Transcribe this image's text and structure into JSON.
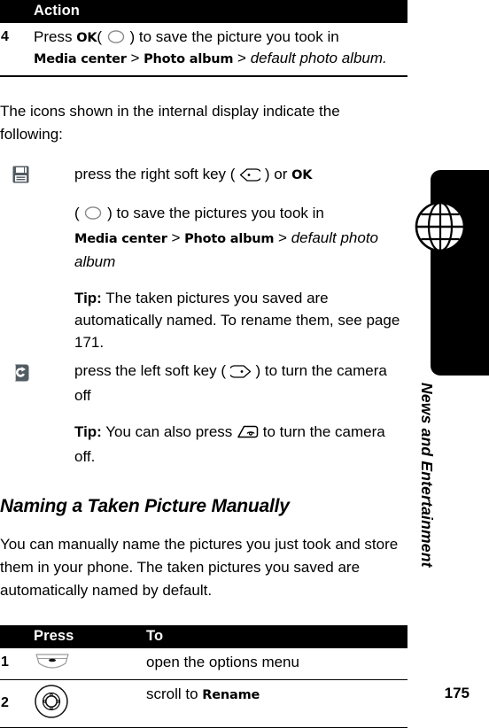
{
  "page": {
    "number": "175",
    "sidebar_label": "News and Entertainment",
    "globe_icon": "globe-icon"
  },
  "action_table": {
    "header": {
      "action": "Action"
    },
    "rows": [
      {
        "num": "4",
        "text_pre": "Press ",
        "ok_bold": "OK",
        "paren_open": "( ",
        "key_icon": "center-select-key-icon",
        "paren_close": " ) to save the picture you took in",
        "path_1": "Media center",
        "sep_1": " > ",
        "path_2": "Photo album",
        "sep_2": " > ",
        "path_3_italic": "default photo album."
      }
    ]
  },
  "intro": {
    "paragraph": "The icons shown in the internal display indicate the following:"
  },
  "icon_list": [
    {
      "icon_name": "save-floppy-icon",
      "line_1_a": "press the right soft key ( ",
      "line_1_icon": "right-soft-key-icon",
      "line_1_b": " ) or ",
      "line_1_ok": "OK",
      "line_2_a": "( ",
      "line_2_icon": "center-select-key-icon",
      "line_2_b": " ) to save the pictures you took in",
      "path_1": "Media center",
      "sep_1": " > ",
      "path_2": "Photo album",
      "sep_2": " > ",
      "path_3_italic": "default photo album",
      "tip_label": "Tip:",
      "tip_text": " The taken pictures you saved are automatically named. To rename them, see page 171."
    },
    {
      "icon_name": "camera-off-icon",
      "line_1_a": "press the left soft key ( ",
      "line_1_icon": "left-soft-key-icon",
      "line_1_b": " ) to turn the camera off",
      "tip_label": "Tip:",
      "tip_text_a": " You can also press ",
      "tip_icon": "end-key-icon",
      "tip_text_b": " to turn the camera off."
    }
  ],
  "section": {
    "heading": "Naming a Taken Picture Manually",
    "paragraph": "You can manually name the pictures you just took and store them in your phone. The taken pictures you saved are automatically named by default."
  },
  "press_table": {
    "header": {
      "press": "Press",
      "to": "To"
    },
    "rows": [
      {
        "num": "1",
        "key_icon": "soft-key-button-icon",
        "to_text": "open the options menu"
      },
      {
        "num": "2",
        "key_icon": "navigation-wheel-icon",
        "to_text_pre": "scroll to ",
        "to_text_bold": "Rename"
      }
    ]
  }
}
